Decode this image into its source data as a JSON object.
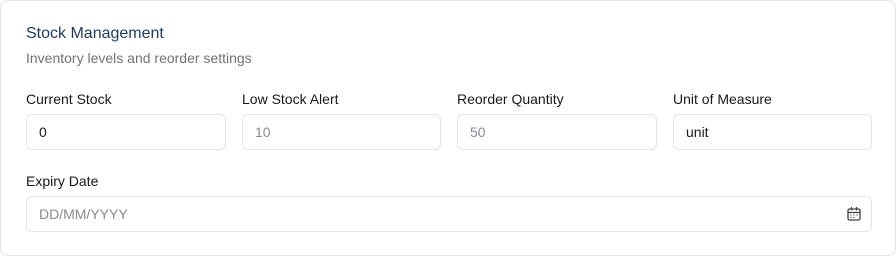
{
  "section": {
    "title": "Stock Management",
    "subtitle": "Inventory levels and reorder settings"
  },
  "fields": {
    "current_stock": {
      "label": "Current Stock",
      "value": "0",
      "placeholder": ""
    },
    "low_stock_alert": {
      "label": "Low Stock Alert",
      "value": "",
      "placeholder": "10"
    },
    "reorder_quantity": {
      "label": "Reorder Quantity",
      "value": "",
      "placeholder": "50"
    },
    "unit_of_measure": {
      "label": "Unit of Measure",
      "value": "unit",
      "placeholder": ""
    },
    "expiry_date": {
      "label": "Expiry Date",
      "value": "",
      "placeholder": "DD/MM/YYYY",
      "icon": "calendar-icon"
    }
  },
  "colors": {
    "title": "#1e3a5f",
    "muted": "#71717a",
    "border": "#e4e4e7"
  }
}
